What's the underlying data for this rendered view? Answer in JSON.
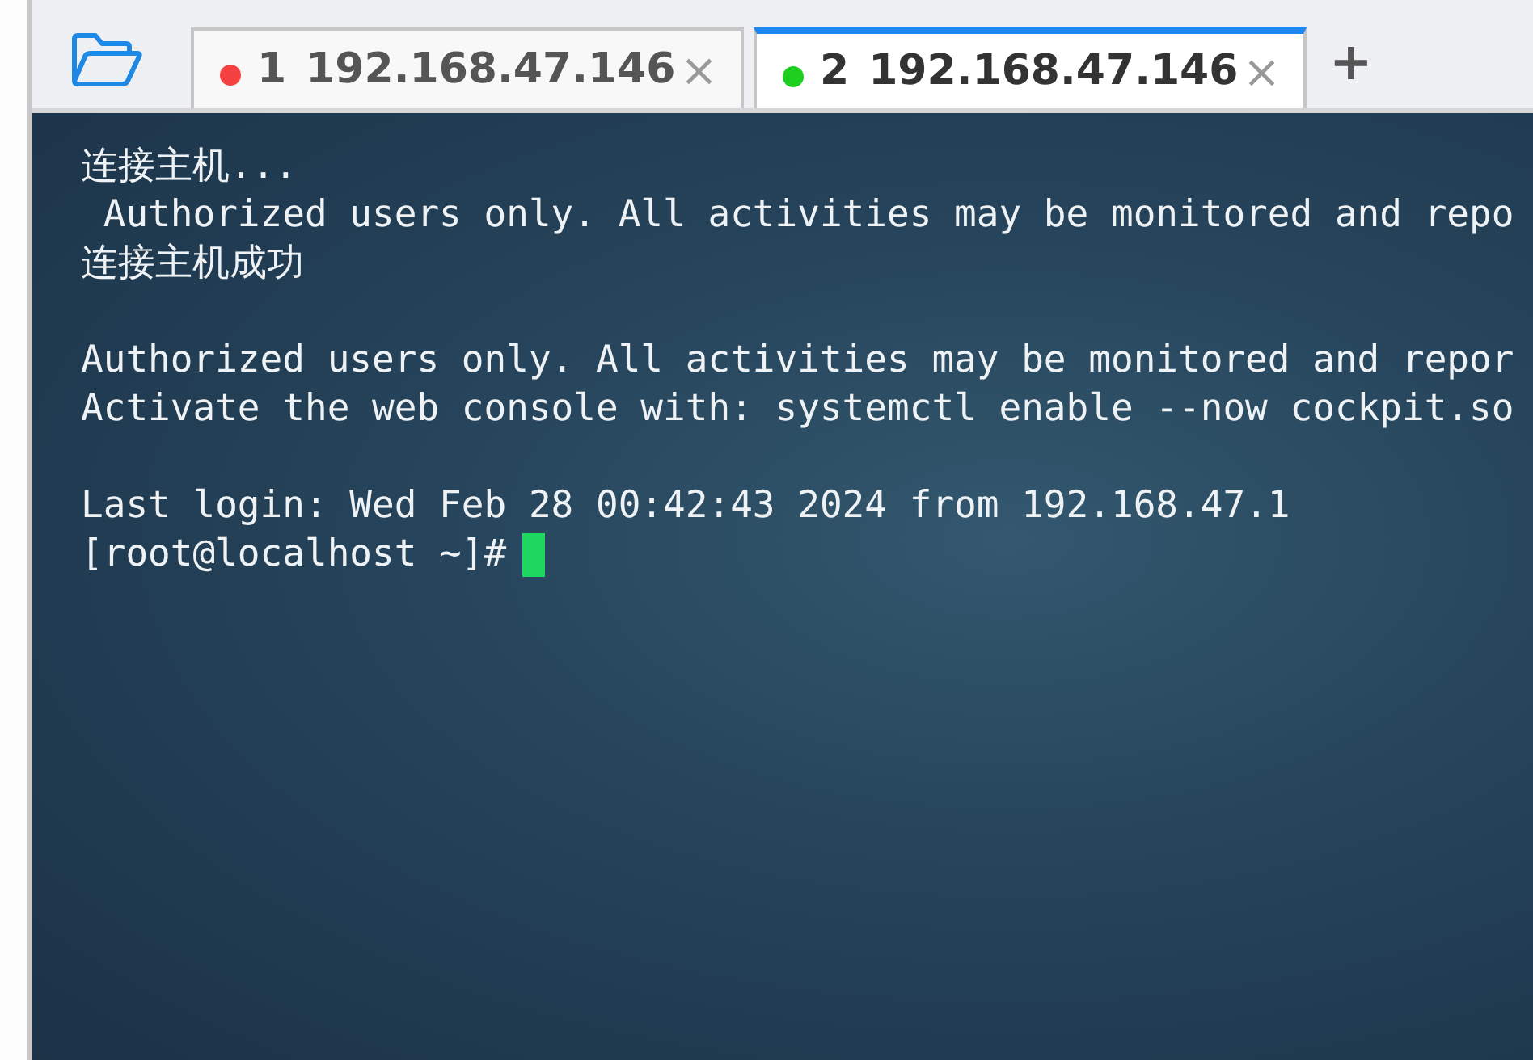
{
  "tabs": [
    {
      "number": "1",
      "title": "192.168.47.146",
      "color": "#f54141",
      "selected": false,
      "close": "×"
    },
    {
      "number": "2",
      "title": "192.168.47.146",
      "color": "#1fcf1f",
      "selected": true,
      "close": "×"
    }
  ],
  "new_tab": "+",
  "terminal": {
    "blocks": [
      [
        "连接主机...",
        " Authorized users only. All activities may be monitored and repo",
        "连接主机成功"
      ],
      [
        "Authorized users only. All activities may be monitored and repor",
        "Activate the web console with: systemctl enable --now cockpit.so"
      ],
      [
        "Last login: Wed Feb 28 00:42:43 2024 from 192.168.47.1"
      ]
    ],
    "prompt": "[root@localhost ~]#",
    "cursor": true
  }
}
